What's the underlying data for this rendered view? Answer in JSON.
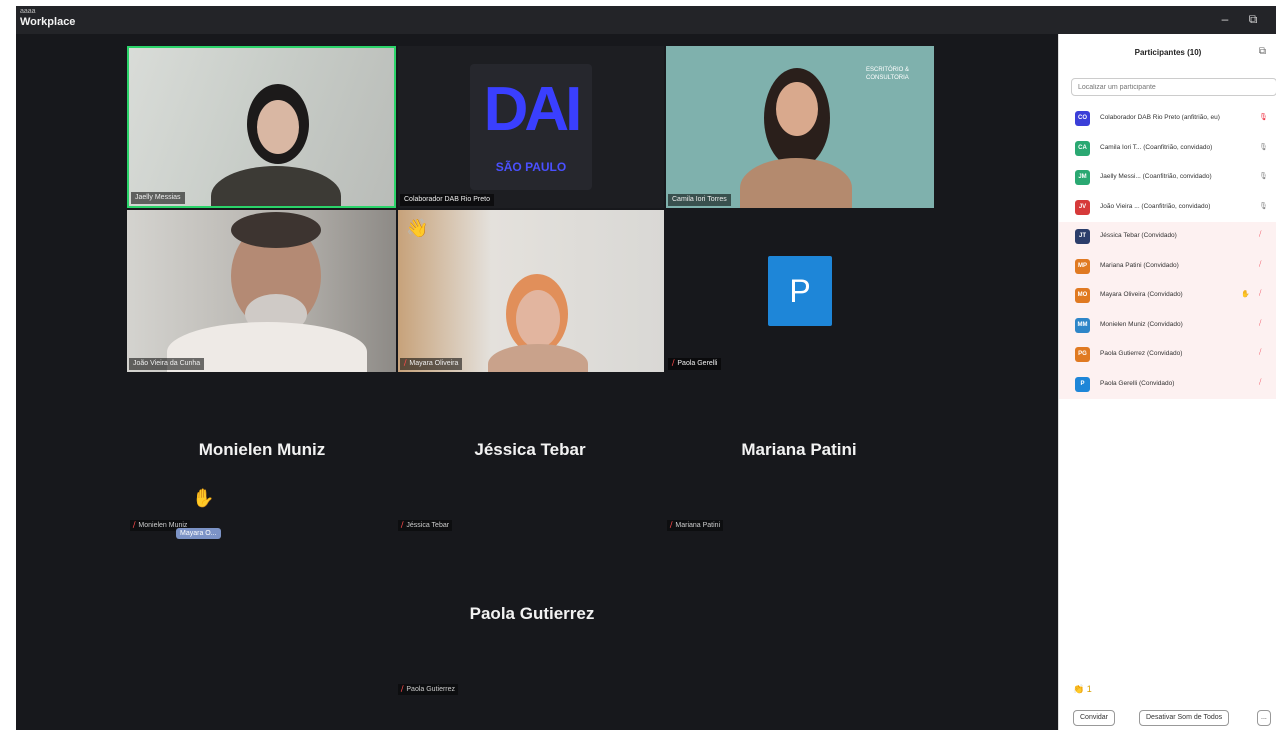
{
  "window": {
    "brand_small": "aaaa",
    "brand": "Workplace",
    "minimize_glyph": "–",
    "restore_glyph": "⧉"
  },
  "tiles": {
    "t1_name": "Jaelly Messias",
    "t2_name": "Colaborador DAB Rio Preto",
    "t2_logo": "DAI",
    "t2_logo_sub": "SÃO PAULO",
    "t3_name": "Camila Iori Torres",
    "t3_badge": "ESCRITÓRIO & CONSULTORIA",
    "t4_name": "João Vieira da Cunha",
    "t5_name": "Mayara Oliveira",
    "t6_name": "Paola Gerelli",
    "t6_avatar": "P"
  },
  "audio_only": {
    "n1": "Monielen Muniz",
    "n1_tag": "Monielen Muniz",
    "n1_hover": "Mayara O...",
    "n2": "Jéssica Tebar",
    "n2_tag": "Jéssica Tebar",
    "n3": "Mariana Patini",
    "n3_tag": "Mariana Patini",
    "n4": "Paola Gutierrez",
    "n4_tag": "Paola Gutierrez"
  },
  "panel": {
    "title": "Participantes (10)",
    "search_placeholder": "Localizar um participante",
    "participants": [
      {
        "initials": "CO",
        "color": "#3b3fd8",
        "name": "Colaborador DAB Rio Preto (anfitrião, eu)"
      },
      {
        "initials": "CA",
        "color": "#2aa872",
        "name": "Camila Iori T... (Coanfitrião, convidado)"
      },
      {
        "initials": "JM",
        "color": "#2aa872",
        "name": "Jaelly Messi... (Coanfitrião, convidado)"
      },
      {
        "initials": "JV",
        "color": "#d63a3a",
        "name": "João Vieira ... (Coanfitrião, convidado)"
      },
      {
        "initials": "JT",
        "color": "#2c3e6b",
        "name": "Jéssica Tebar (Convidado)"
      },
      {
        "initials": "MP",
        "color": "#e07a22",
        "name": "Mariana Patini (Convidado)"
      },
      {
        "initials": "MO",
        "color": "#e07a22",
        "name": "Mayara Oliveira (Convidado)"
      },
      {
        "initials": "MM",
        "color": "#2e86c8",
        "name": "Monielen Muniz (Convidado)"
      },
      {
        "initials": "PG",
        "color": "#e07a22",
        "name": "Paola Gutierrez (Convidado)"
      },
      {
        "initials": "P",
        "color": "#1e86d8",
        "name": "Paola Gerelli (Convidado)"
      }
    ],
    "reactions": "👏 1",
    "invite_label": "Convidar",
    "mute_all_label": "Desativar Som de Todos",
    "more_label": "..."
  }
}
